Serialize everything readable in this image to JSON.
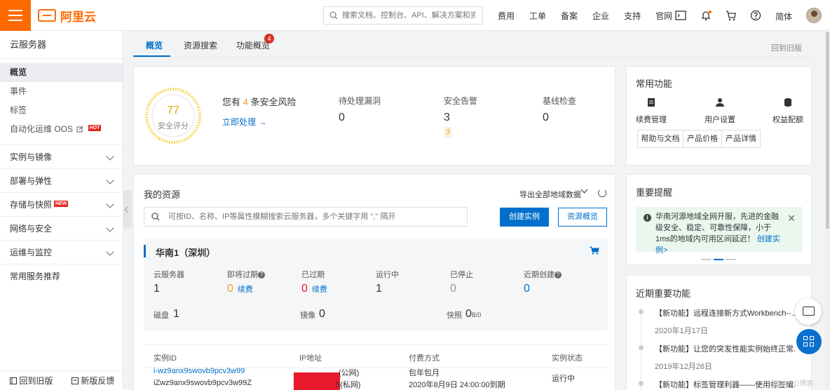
{
  "topbar": {
    "brand": "阿里云",
    "search_placeholder": "搜索文档、控制台、API、解决方案和资源",
    "nav": [
      "费用",
      "工单",
      "备案",
      "企业",
      "支持",
      "官网"
    ],
    "language": "简体"
  },
  "sidebar": {
    "title": "云服务器",
    "items": [
      {
        "label": "概览"
      },
      {
        "label": "事件"
      },
      {
        "label": "标签"
      },
      {
        "label": "自动化运维 OOS",
        "badge": "HOT"
      }
    ],
    "groups": [
      {
        "label": "实例与镜像"
      },
      {
        "label": "部署与弹性"
      },
      {
        "label": "存储与快照",
        "badge": "NEW"
      },
      {
        "label": "网络与安全"
      },
      {
        "label": "运维与监控"
      }
    ],
    "recommend": "常用服务推荐",
    "bottom": {
      "old_version": "回到旧版",
      "feedback": "新版反馈"
    }
  },
  "tabs": {
    "items": [
      {
        "label": "概览"
      },
      {
        "label": "资源搜索"
      },
      {
        "label": "功能概览",
        "badge": "4"
      }
    ],
    "back_old": "回到旧版"
  },
  "security": {
    "score": "77",
    "score_label": "安全评分",
    "risk_prefix": "您有",
    "risk_count": "4",
    "risk_suffix": "条安全风险",
    "action": "立即处理 →",
    "stats": [
      {
        "label": "待处理漏洞",
        "value": "0"
      },
      {
        "label": "安全告警",
        "value": "3"
      },
      {
        "label": "基线检查",
        "value": "0"
      }
    ],
    "alert_mini": "3"
  },
  "common": {
    "title": "常用功能",
    "items": [
      "续费管理",
      "用户设置",
      "权益配额"
    ],
    "buttons": [
      "帮助与文档",
      "产品价格",
      "产品详情"
    ]
  },
  "resources": {
    "title": "我的资源",
    "export": "导出全部地域数据",
    "search_placeholder": "可按ID、名称、IP等属性模糊搜索云服务器，多个关键字用 \",\" 隔开",
    "create": "创建实例",
    "overview": "资源概览",
    "region": {
      "name": "华南1（深圳）",
      "stats": [
        {
          "label": "云服务器",
          "value": "1"
        },
        {
          "label": "即将过期",
          "value": "0",
          "link": "续费"
        },
        {
          "label": "已过期",
          "value": "0",
          "link": "续费"
        },
        {
          "label": "运行中",
          "value": "1"
        },
        {
          "label": "已停止",
          "value": "0"
        },
        {
          "label": "近期创建",
          "value": "0"
        }
      ],
      "disk_label": "磁盘",
      "disk_value": "1",
      "image_label": "镜像",
      "image_value": "0",
      "snapshot_label": "快照",
      "snapshot_value": "0",
      "snapshot_unit": "B/0"
    },
    "table": {
      "headers": [
        "实例ID",
        "IP地址",
        "付费方式",
        "实例状态"
      ],
      "row": {
        "id": "i-wz9anx9swovb9pcv3w99",
        "name": "iZwz9anx9swovb9pcv3w99Z",
        "ip_public": "(公网)",
        "ip_private": "5(私网)",
        "billing": "包年包月",
        "expire": "2020年8月9日 24:00:00到期",
        "status": "运行中"
      }
    }
  },
  "announcement": {
    "title": "重要提醒",
    "text": "华南河源地域全网开服，先进的金融级安全、稳定、可靠性保障，小于1ms的地域内可用区间延迟！",
    "link": "创建实例>"
  },
  "features": {
    "title": "近期重要功能",
    "items": [
      {
        "text": "【新功能】远程连接新方式Workbench--...",
        "date": "2020年1月17日"
      },
      {
        "text": "【新功能】让您的突发性能实例始终正常...",
        "date": "2019年12月26日"
      },
      {
        "text": "【新功能】标签管理利器——使用标签编..."
      }
    ]
  },
  "watermark": "@51CTO博客",
  "colors": {
    "brand": "#ff6a00",
    "primary": "#0070cc",
    "warning": "#f0a020",
    "danger": "#e8192c"
  }
}
